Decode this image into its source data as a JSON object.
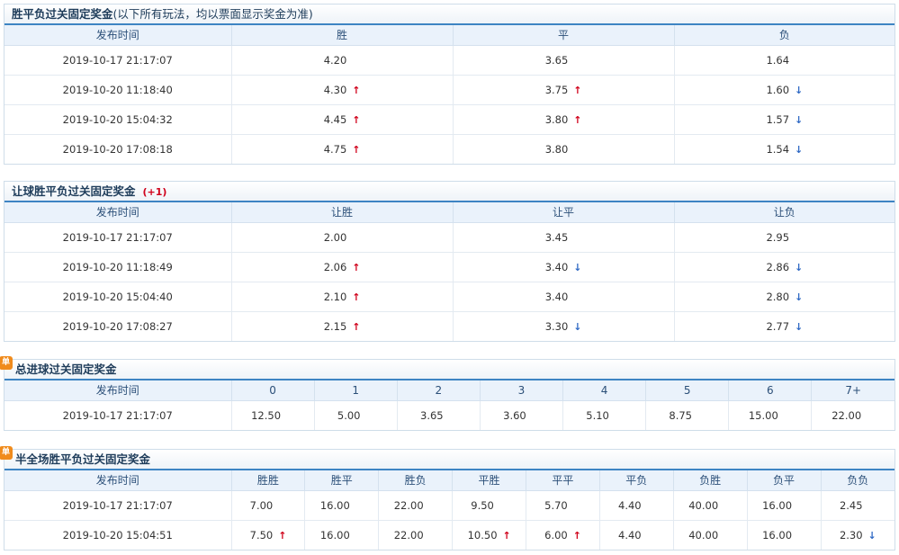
{
  "s1": {
    "title": "胜平负过关固定奖金",
    "note": "(以下所有玩法，均以票面显示奖金为准)",
    "headers": [
      "发布时间",
      "胜",
      "平",
      "负"
    ],
    "rows": [
      {
        "time": "2019-10-17 21:17:07",
        "v": [
          {
            "val": "4.20",
            "dir": ""
          },
          {
            "val": "3.65",
            "dir": ""
          },
          {
            "val": "1.64",
            "dir": ""
          }
        ]
      },
      {
        "time": "2019-10-20 11:18:40",
        "v": [
          {
            "val": "4.30",
            "dir": "up"
          },
          {
            "val": "3.75",
            "dir": "up"
          },
          {
            "val": "1.60",
            "dir": "down"
          }
        ]
      },
      {
        "time": "2019-10-20 15:04:32",
        "v": [
          {
            "val": "4.45",
            "dir": "up"
          },
          {
            "val": "3.80",
            "dir": "up"
          },
          {
            "val": "1.57",
            "dir": "down"
          }
        ]
      },
      {
        "time": "2019-10-20 17:08:18",
        "v": [
          {
            "val": "4.75",
            "dir": "up"
          },
          {
            "val": "3.80",
            "dir": ""
          },
          {
            "val": "1.54",
            "dir": "down"
          }
        ]
      }
    ]
  },
  "s2": {
    "title": "让球胜平负过关固定奖金",
    "handicap": "(+1)",
    "headers": [
      "发布时间",
      "让胜",
      "让平",
      "让负"
    ],
    "rows": [
      {
        "time": "2019-10-17 21:17:07",
        "v": [
          {
            "val": "2.00",
            "dir": ""
          },
          {
            "val": "3.45",
            "dir": ""
          },
          {
            "val": "2.95",
            "dir": ""
          }
        ]
      },
      {
        "time": "2019-10-20 11:18:49",
        "v": [
          {
            "val": "2.06",
            "dir": "up"
          },
          {
            "val": "3.40",
            "dir": "down"
          },
          {
            "val": "2.86",
            "dir": "down"
          }
        ]
      },
      {
        "time": "2019-10-20 15:04:40",
        "v": [
          {
            "val": "2.10",
            "dir": "up"
          },
          {
            "val": "3.40",
            "dir": ""
          },
          {
            "val": "2.80",
            "dir": "down"
          }
        ]
      },
      {
        "time": "2019-10-20 17:08:27",
        "v": [
          {
            "val": "2.15",
            "dir": "up"
          },
          {
            "val": "3.30",
            "dir": "down"
          },
          {
            "val": "2.77",
            "dir": "down"
          }
        ]
      }
    ]
  },
  "s3": {
    "badge": "单",
    "title": "总进球过关固定奖金",
    "headers": [
      "发布时间",
      "0",
      "1",
      "2",
      "3",
      "4",
      "5",
      "6",
      "7+"
    ],
    "rows": [
      {
        "time": "2019-10-17 21:17:07",
        "v": [
          {
            "val": "12.50",
            "dir": ""
          },
          {
            "val": "5.00",
            "dir": ""
          },
          {
            "val": "3.65",
            "dir": ""
          },
          {
            "val": "3.60",
            "dir": ""
          },
          {
            "val": "5.10",
            "dir": ""
          },
          {
            "val": "8.75",
            "dir": ""
          },
          {
            "val": "15.00",
            "dir": ""
          },
          {
            "val": "22.00",
            "dir": ""
          }
        ]
      }
    ]
  },
  "s4": {
    "badge": "单",
    "title": "半全场胜平负过关固定奖金",
    "headers": [
      "发布时间",
      "胜胜",
      "胜平",
      "胜负",
      "平胜",
      "平平",
      "平负",
      "负胜",
      "负平",
      "负负"
    ],
    "rows": [
      {
        "time": "2019-10-17 21:17:07",
        "v": [
          {
            "val": "7.00",
            "dir": ""
          },
          {
            "val": "16.00",
            "dir": ""
          },
          {
            "val": "22.00",
            "dir": ""
          },
          {
            "val": "9.50",
            "dir": ""
          },
          {
            "val": "5.70",
            "dir": ""
          },
          {
            "val": "4.40",
            "dir": ""
          },
          {
            "val": "40.00",
            "dir": ""
          },
          {
            "val": "16.00",
            "dir": ""
          },
          {
            "val": "2.45",
            "dir": ""
          }
        ]
      },
      {
        "time": "2019-10-20 15:04:51",
        "v": [
          {
            "val": "7.50",
            "dir": "up"
          },
          {
            "val": "16.00",
            "dir": ""
          },
          {
            "val": "22.00",
            "dir": ""
          },
          {
            "val": "10.50",
            "dir": "up"
          },
          {
            "val": "6.00",
            "dir": "up"
          },
          {
            "val": "4.40",
            "dir": ""
          },
          {
            "val": "40.00",
            "dir": ""
          },
          {
            "val": "16.00",
            "dir": ""
          },
          {
            "val": "2.30",
            "dir": "down"
          }
        ]
      }
    ]
  },
  "icons": {
    "up": "arrow-up-icon",
    "down": "arrow-down-icon"
  },
  "colors": {
    "up": "#d0021b",
    "down": "#2f69c4",
    "header_rule": "#3d84c3",
    "badge": "#f08b1c"
  }
}
